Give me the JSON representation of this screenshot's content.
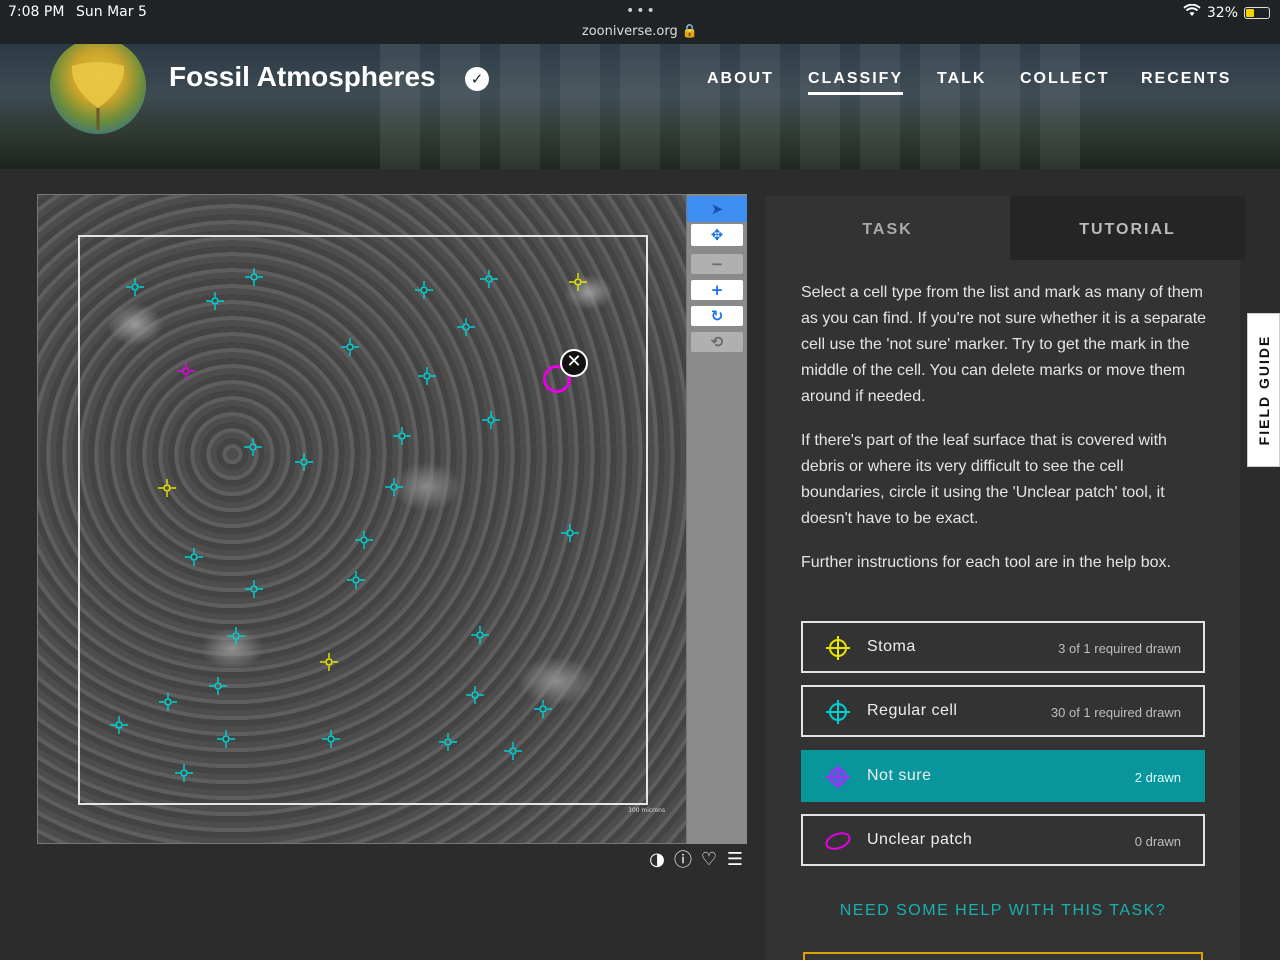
{
  "status_bar": {
    "time": "7:08 PM",
    "date": "Sun Mar 5",
    "url": "zooniverse.org",
    "battery": "32%"
  },
  "header": {
    "project_title": "Fossil Atmospheres",
    "nav": [
      "ABOUT",
      "CLASSIFY",
      "TALK",
      "COLLECT",
      "RECENTS"
    ],
    "active_nav": "CLASSIFY"
  },
  "viewer": {
    "scale_label": "300 microns",
    "toolbar": [
      "pointer-icon",
      "pan-icon",
      "zoom-out-icon",
      "zoom-in-icon",
      "rotate-icon",
      "reset-icon"
    ],
    "footer_icons": [
      "invert-icon",
      "metadata-icon",
      "favorite-icon",
      "collections-icon"
    ]
  },
  "task_panel": {
    "tabs": [
      "TASK",
      "TUTORIAL"
    ],
    "instructions": [
      "Select a cell type from the list and mark as many of them as you can find. If you're not sure whether it is a separate cell use the 'not sure' marker. Try to get the mark in the middle of the cell. You can delete marks or move them around if needed.",
      "If there's part of the leaf surface that is covered with debris or where its very difficult to see the cell boundaries, circle it using the 'Unclear patch' tool, it doesn't have to be exact.",
      "Further instructions for each tool are in the help box."
    ],
    "tools": [
      {
        "label": "Stoma",
        "count": "3 of 1 required drawn",
        "color": "#e6e600"
      },
      {
        "label": "Regular cell",
        "count": "30 of 1 required drawn",
        "color": "#00d2d2"
      },
      {
        "label": "Not sure",
        "count": "2 drawn",
        "color": "#9b30ff"
      },
      {
        "label": "Unclear patch",
        "count": "0 drawn",
        "color": "#e600e6"
      }
    ],
    "help_link": "NEED SOME HELP WITH THIS TASK?"
  },
  "field_guide": "FIELD GUIDE"
}
